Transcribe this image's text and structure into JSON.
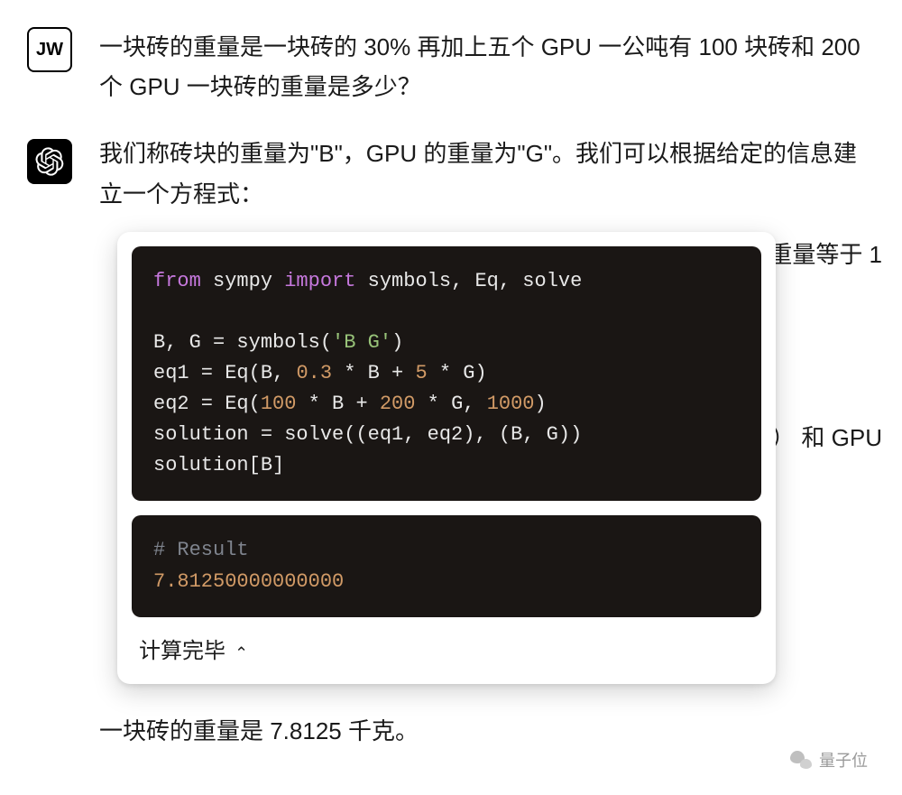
{
  "user": {
    "avatar_text": "JW",
    "message": "一块砖的重量是一块砖的 30% 再加上五个 GPU 一公吨有 100 块砖和 200 个 GPU 一块砖的重量是多少？"
  },
  "assistant": {
    "intro": "我们称砖块的重量为\"B\"，GPU 的重量为\"G\"。我们可以根据给定的信息建立一个方程式：",
    "behind_text_1": "重量等于 1",
    "behind_text_2": "） 和 GPU",
    "code": {
      "line1_from": "from",
      "line1_mid": " sympy ",
      "line1_import": "import",
      "line1_rest": " symbols, Eq, solve",
      "line2_pre": "B, G = symbols(",
      "line2_str": "'B G'",
      "line2_post": ")",
      "line3_pre": "eq1 = Eq(B, ",
      "line3_n1": "0.3",
      "line3_m1": " * B + ",
      "line3_n2": "5",
      "line3_m2": " * G)",
      "line4_pre": "eq2 = Eq(",
      "line4_n1": "100",
      "line4_m1": " * B + ",
      "line4_n2": "200",
      "line4_m2": " * G, ",
      "line4_n3": "1000",
      "line4_post": ")",
      "line5": "solution = solve((eq1, eq2), (B, G))",
      "line6": "solution[B]"
    },
    "result": {
      "comment": "# Result",
      "value": "7.81250000000000"
    },
    "calc_done_label": "计算完毕",
    "final_answer": "一块砖的重量是 7.8125 千克。"
  },
  "watermark": {
    "text": "量子位"
  }
}
